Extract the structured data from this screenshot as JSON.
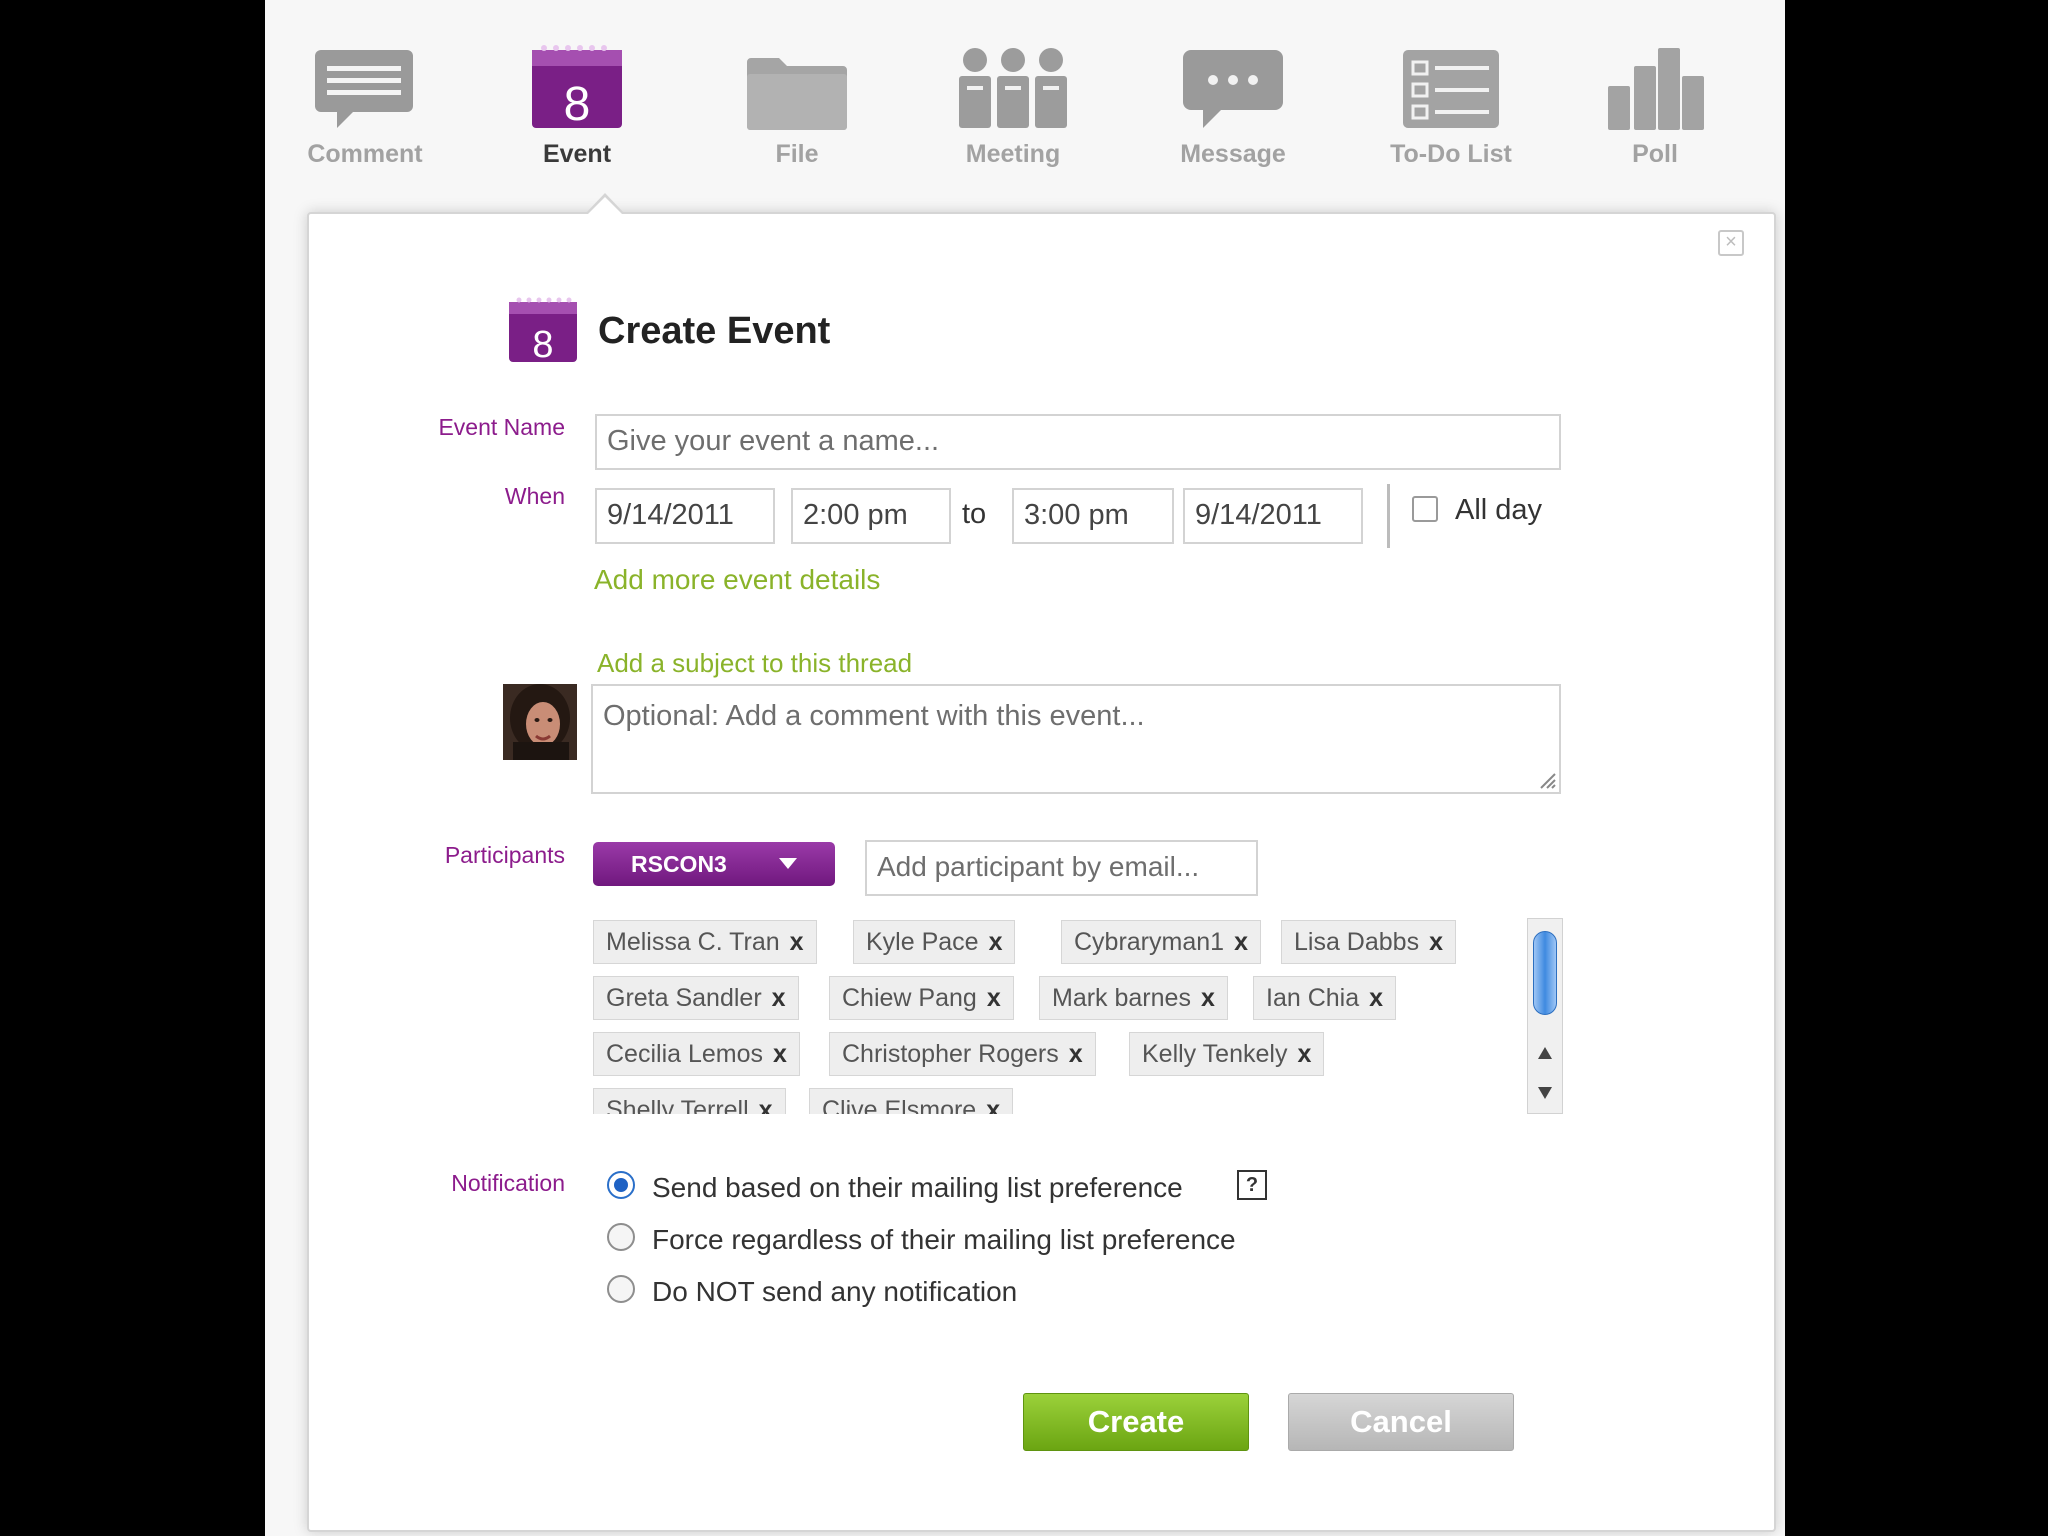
{
  "toolbar": {
    "items": [
      {
        "label": "Comment",
        "icon": "comment-icon"
      },
      {
        "label": "Event",
        "icon": "calendar-icon",
        "icon_text": "8",
        "active": true
      },
      {
        "label": "File",
        "icon": "folder-icon"
      },
      {
        "label": "Meeting",
        "icon": "people-icon"
      },
      {
        "label": "Message",
        "icon": "chat-bubble-icon"
      },
      {
        "label": "To-Do List",
        "icon": "checklist-icon"
      },
      {
        "label": "Poll",
        "icon": "bar-chart-icon"
      }
    ]
  },
  "dialog": {
    "close_glyph": "×",
    "title": "Create Event",
    "title_icon_text": "8",
    "event_name": {
      "label": "Event Name",
      "placeholder": "Give your event a name..."
    },
    "when": {
      "label": "When",
      "start_date": "9/14/2011",
      "start_time": "2:00 pm",
      "to_label": "to",
      "end_time": "3:00 pm",
      "end_date": "9/14/2011",
      "all_day_label": "All day",
      "all_day_checked": false
    },
    "add_details_link": "Add more event details",
    "subject_link": "Add a subject to this thread",
    "comment_placeholder": "Optional: Add a comment with this event...",
    "participants": {
      "label": "Participants",
      "group_button": "RSCON3",
      "email_placeholder": "Add participant by email...",
      "remove_glyph": "x",
      "chips": [
        "Melissa C. Tran",
        "Kyle Pace",
        "Cybraryman1",
        "Lisa Dabbs",
        "Greta Sandler",
        "Chiew Pang",
        "Mark barnes",
        "Ian Chia",
        "Cecilia Lemos",
        "Christopher Rogers",
        "Kelly Tenkely",
        "Shelly Terrell",
        "Clive Elsmore"
      ]
    },
    "notification": {
      "label": "Notification",
      "help_glyph": "?",
      "options": [
        {
          "label": "Send based on their mailing list preference",
          "checked": true
        },
        {
          "label": "Force regardless of their mailing list preference",
          "checked": false
        },
        {
          "label": "Do NOT send any notification",
          "checked": false
        }
      ]
    },
    "create_button": "Create",
    "cancel_button": "Cancel"
  },
  "colors": {
    "accent_purple": "#7a1f86",
    "link_green": "#8ab32a",
    "create_green": "#7cb518",
    "cancel_gray": "#c4c4c4"
  }
}
